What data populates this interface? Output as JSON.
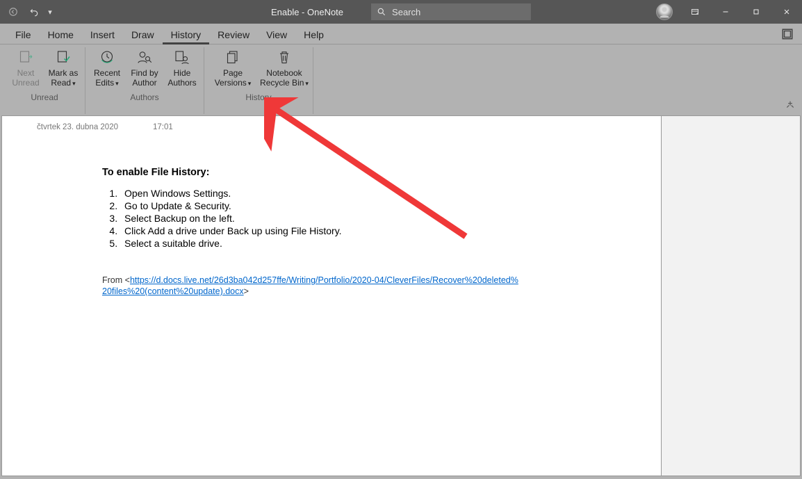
{
  "titlebar": {
    "doc_title": "Enable  -  OneNote",
    "search_placeholder": "Search"
  },
  "menus": {
    "file": "File",
    "home": "Home",
    "insert": "Insert",
    "draw": "Draw",
    "history": "History",
    "review": "Review",
    "view": "View",
    "help": "Help"
  },
  "ribbon": {
    "groups": {
      "unread": {
        "label": "Unread",
        "next_unread": "Next\nUnread",
        "mark_as_read": "Mark as\nRead"
      },
      "authors": {
        "label": "Authors",
        "recent_edits": "Recent\nEdits",
        "find_by_author": "Find by\nAuthor",
        "hide_authors": "Hide\nAuthors"
      },
      "history": {
        "label": "History",
        "page_versions": "Page\nVersions",
        "recycle_bin": "Notebook\nRecycle Bin"
      }
    }
  },
  "page": {
    "date": "čtvrtek 23. dubna 2020",
    "time": "17:01",
    "heading": "To enable File History:",
    "steps": [
      "Open Windows Settings.",
      "Go to Update & Security.",
      "Select Backup on the left.",
      "Click Add a drive under Back up using File History.",
      "Select a suitable drive."
    ],
    "source_prefix": "From <",
    "source_url": "https://d.docs.live.net/26d3ba042d257ffe/Writing/Portfolio/2020-04/CleverFiles/Recover%20deleted%20files%20(content%20update).docx",
    "source_suffix": ">"
  }
}
